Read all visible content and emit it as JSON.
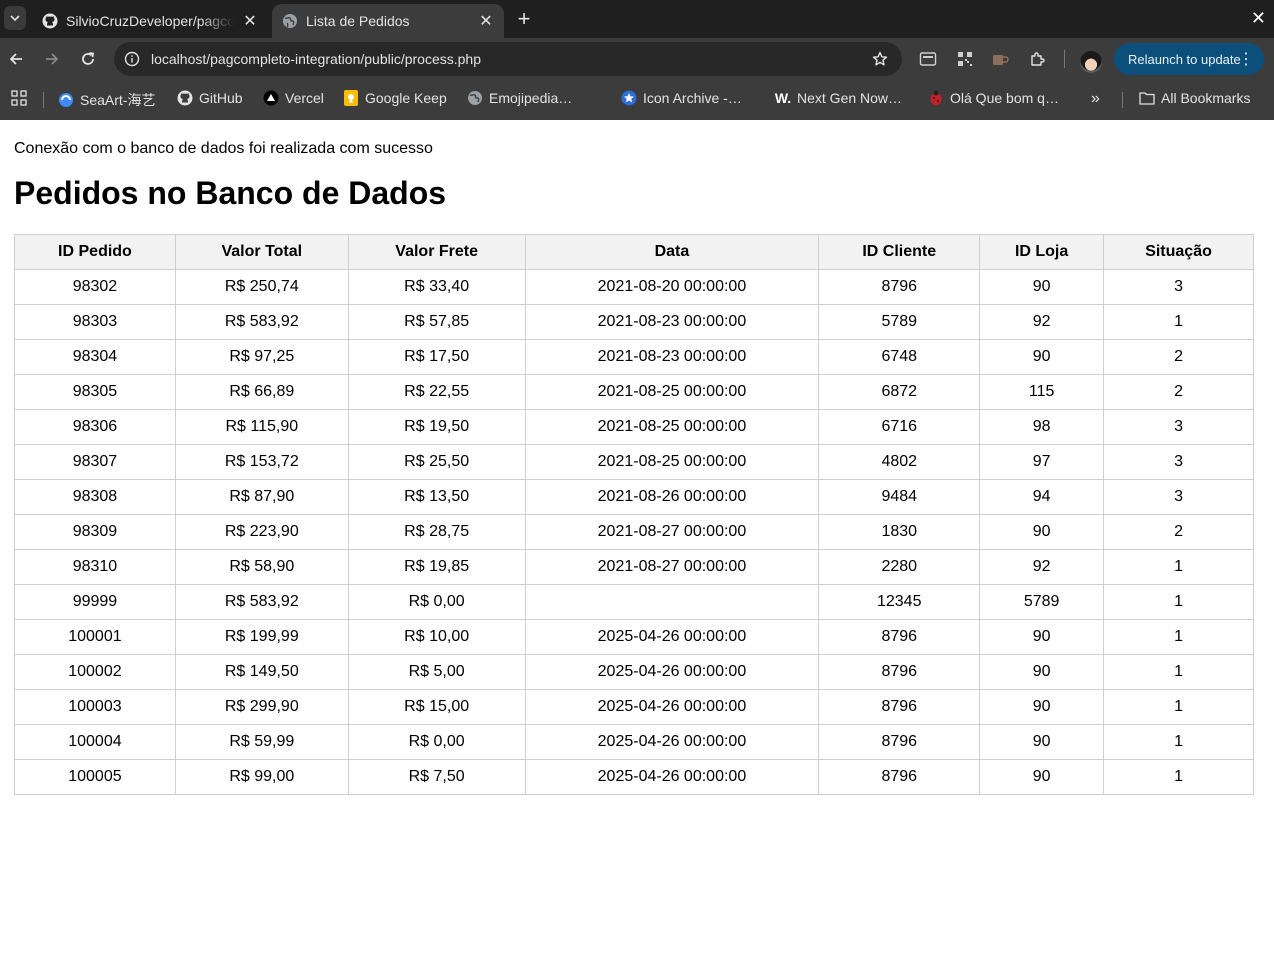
{
  "browser": {
    "tabs": [
      {
        "title": "SilvioCruzDeveloper/pagcompleto-integration",
        "icon": "github-icon",
        "active": false
      },
      {
        "title": "Lista de Pedidos",
        "icon": "globe-icon",
        "active": true
      }
    ],
    "url": "localhost/pagcompleto-integration/public/process.php",
    "relaunch_label": "Relaunch to update",
    "bookmarks": [
      {
        "label": "SeaArt-海艺",
        "icon": "seaart-icon"
      },
      {
        "label": "GitHub",
        "icon": "github-icon"
      },
      {
        "label": "Vercel",
        "icon": "vercel-icon"
      },
      {
        "label": "Google Keep",
        "icon": "keep-icon"
      },
      {
        "label": "Emojipedia…",
        "icon": "emojipedia-icon"
      },
      {
        "label": "Icon Archive -…",
        "icon": "star-badge-icon"
      },
      {
        "label": "Next Gen Now…",
        "icon": "w-logo-icon"
      },
      {
        "label": "Olá Que bom q…",
        "icon": "ladybug-icon"
      }
    ],
    "all_bookmarks_label": "All Bookmarks"
  },
  "page": {
    "status_message": "Conexão com o banco de dados foi realizada com sucesso",
    "heading": "Pedidos no Banco de Dados",
    "table": {
      "headers": [
        "ID Pedido",
        "Valor Total",
        "Valor Frete",
        "Data",
        "ID Cliente",
        "ID Loja",
        "Situação"
      ],
      "rows": [
        [
          "98302",
          "R$ 250,74",
          "R$ 33,40",
          "2021-08-20 00:00:00",
          "8796",
          "90",
          "3"
        ],
        [
          "98303",
          "R$ 583,92",
          "R$ 57,85",
          "2021-08-23 00:00:00",
          "5789",
          "92",
          "1"
        ],
        [
          "98304",
          "R$ 97,25",
          "R$ 17,50",
          "2021-08-23 00:00:00",
          "6748",
          "90",
          "2"
        ],
        [
          "98305",
          "R$ 66,89",
          "R$ 22,55",
          "2021-08-25 00:00:00",
          "6872",
          "115",
          "2"
        ],
        [
          "98306",
          "R$ 115,90",
          "R$ 19,50",
          "2021-08-25 00:00:00",
          "6716",
          "98",
          "3"
        ],
        [
          "98307",
          "R$ 153,72",
          "R$ 25,50",
          "2021-08-25 00:00:00",
          "4802",
          "97",
          "3"
        ],
        [
          "98308",
          "R$ 87,90",
          "R$ 13,50",
          "2021-08-26 00:00:00",
          "9484",
          "94",
          "3"
        ],
        [
          "98309",
          "R$ 223,90",
          "R$ 28,75",
          "2021-08-27 00:00:00",
          "1830",
          "90",
          "2"
        ],
        [
          "98310",
          "R$ 58,90",
          "R$ 19,85",
          "2021-08-27 00:00:00",
          "2280",
          "92",
          "1"
        ],
        [
          "99999",
          "R$ 583,92",
          "R$ 0,00",
          "",
          "12345",
          "5789",
          "1"
        ],
        [
          "100001",
          "R$ 199,99",
          "R$ 10,00",
          "2025-04-26 00:00:00",
          "8796",
          "90",
          "1"
        ],
        [
          "100002",
          "R$ 149,50",
          "R$ 5,00",
          "2025-04-26 00:00:00",
          "8796",
          "90",
          "1"
        ],
        [
          "100003",
          "R$ 299,90",
          "R$ 15,00",
          "2025-04-26 00:00:00",
          "8796",
          "90",
          "1"
        ],
        [
          "100004",
          "R$ 59,99",
          "R$ 0,00",
          "2025-04-26 00:00:00",
          "8796",
          "90",
          "1"
        ],
        [
          "100005",
          "R$ 99,00",
          "R$ 7,50",
          "2025-04-26 00:00:00",
          "8796",
          "90",
          "1"
        ]
      ]
    }
  }
}
